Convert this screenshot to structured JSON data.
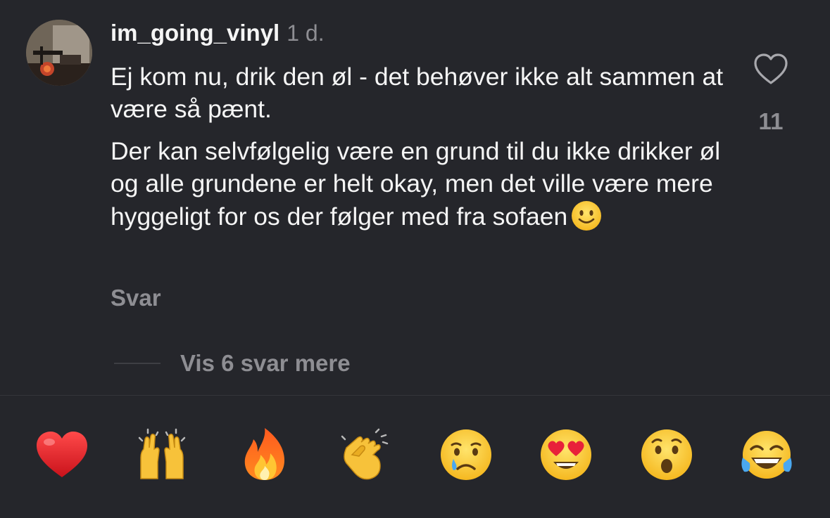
{
  "comment": {
    "username": "im_going_vinyl",
    "timestamp": "1 d.",
    "paragraph1": "Ej kom nu, drik den øl - det behøver ikke alt sammen at være så pænt.",
    "paragraph2": "Der kan selvfølgelig være en grund til du ikke drikker øl og alle grundene er helt okay, men det ville være mere hyggeligt for os der følger med fra sofaen",
    "inline_emoji": "slightly-smiling-face",
    "reply_label": "Svar",
    "like_icon": "heart-outline-icon",
    "like_count": "11",
    "more_replies_label": "Vis 6 svar mere"
  },
  "reactions": [
    {
      "name": "red-heart"
    },
    {
      "name": "raising-hands"
    },
    {
      "name": "fire"
    },
    {
      "name": "clapping-hands"
    },
    {
      "name": "crying-face"
    },
    {
      "name": "heart-eyes-face"
    },
    {
      "name": "surprised-face"
    },
    {
      "name": "tears-of-joy-face"
    }
  ],
  "colors": {
    "background": "#25262b",
    "primary_text": "#f5f5f5",
    "secondary_text": "#8e8e93"
  }
}
